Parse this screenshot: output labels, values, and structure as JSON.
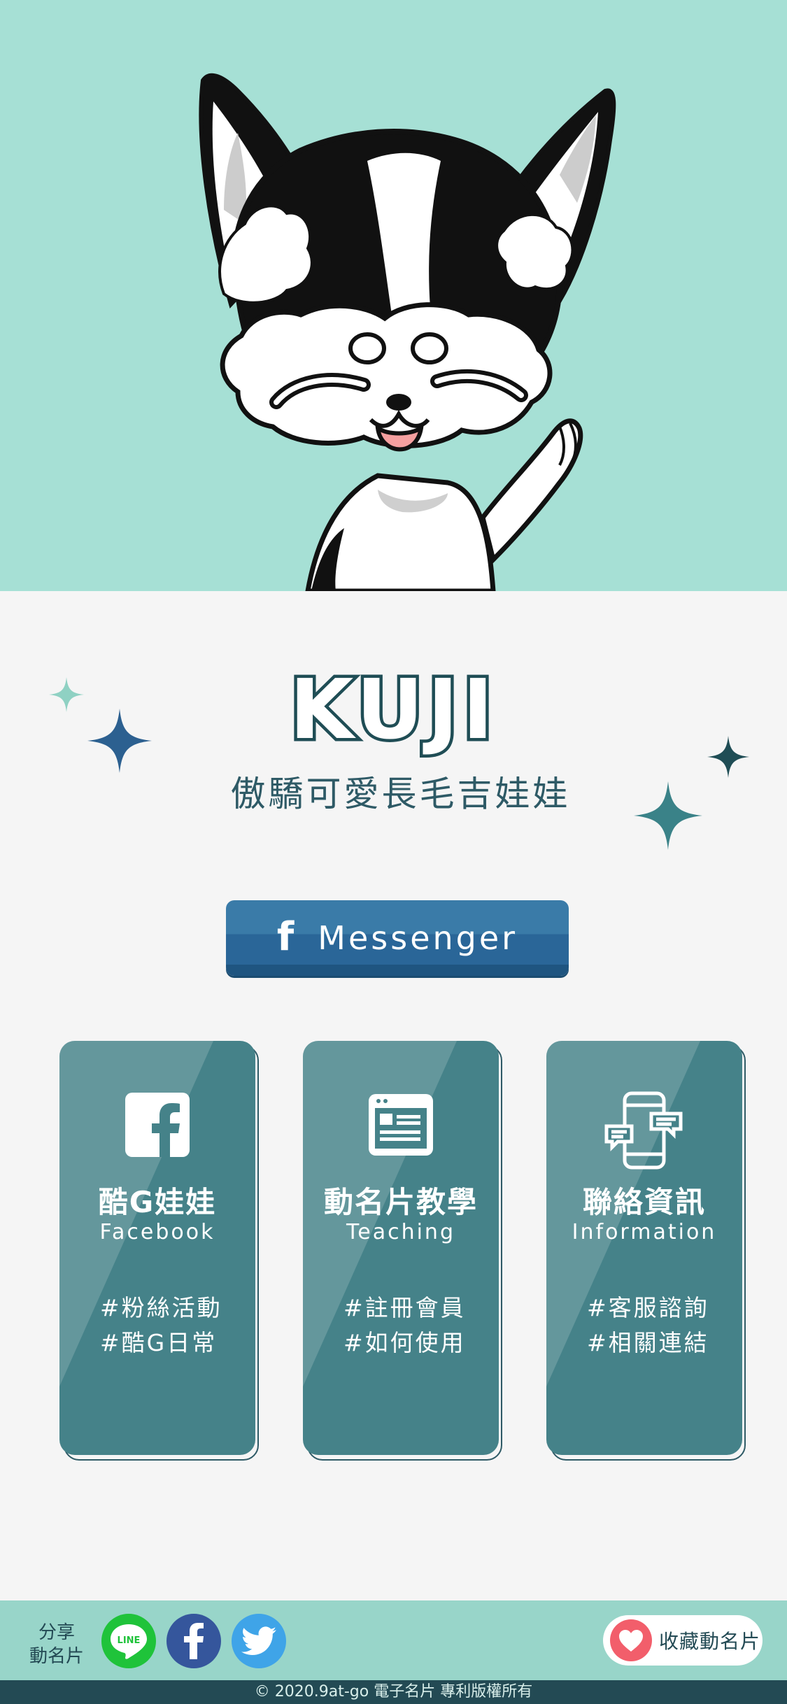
{
  "hero": {
    "character": "dog-illustration"
  },
  "profile": {
    "name": "KUJI",
    "tagline": "傲驕可愛長毛吉娃娃"
  },
  "messenger_button": {
    "icon": "facebook-f-icon",
    "label": "Messenger"
  },
  "cards": [
    {
      "title": "酷G娃娃",
      "subtitle": "Facebook",
      "icon": "facebook-icon",
      "tags": [
        "#粉絲活動",
        "#酷G日常"
      ]
    },
    {
      "title": "動名片教學",
      "subtitle": "Teaching",
      "icon": "browser-list-icon",
      "tags": [
        "#註冊會員",
        "#如何使用"
      ]
    },
    {
      "title": "聯絡資訊",
      "subtitle": "Information",
      "icon": "phone-chat-icon",
      "tags": [
        "#客服諮詢",
        "#相關連結"
      ]
    }
  ],
  "footer": {
    "share_label_line1": "分享",
    "share_label_line2": "動名片",
    "line_label": "LINE",
    "favorite_label": "收藏動名片",
    "copyright": "© 2020.9at-go 電子名片 專利版權所有"
  },
  "colors": {
    "hero_bg": "#a6e0d5",
    "card": "#458289",
    "dark_teal": "#234a54",
    "messenger": "#2a6698",
    "line_green": "#1fc33a",
    "facebook_blue": "#35569c",
    "twitter_blue": "#3fa4e8",
    "heart_pink": "#f25e6b"
  }
}
